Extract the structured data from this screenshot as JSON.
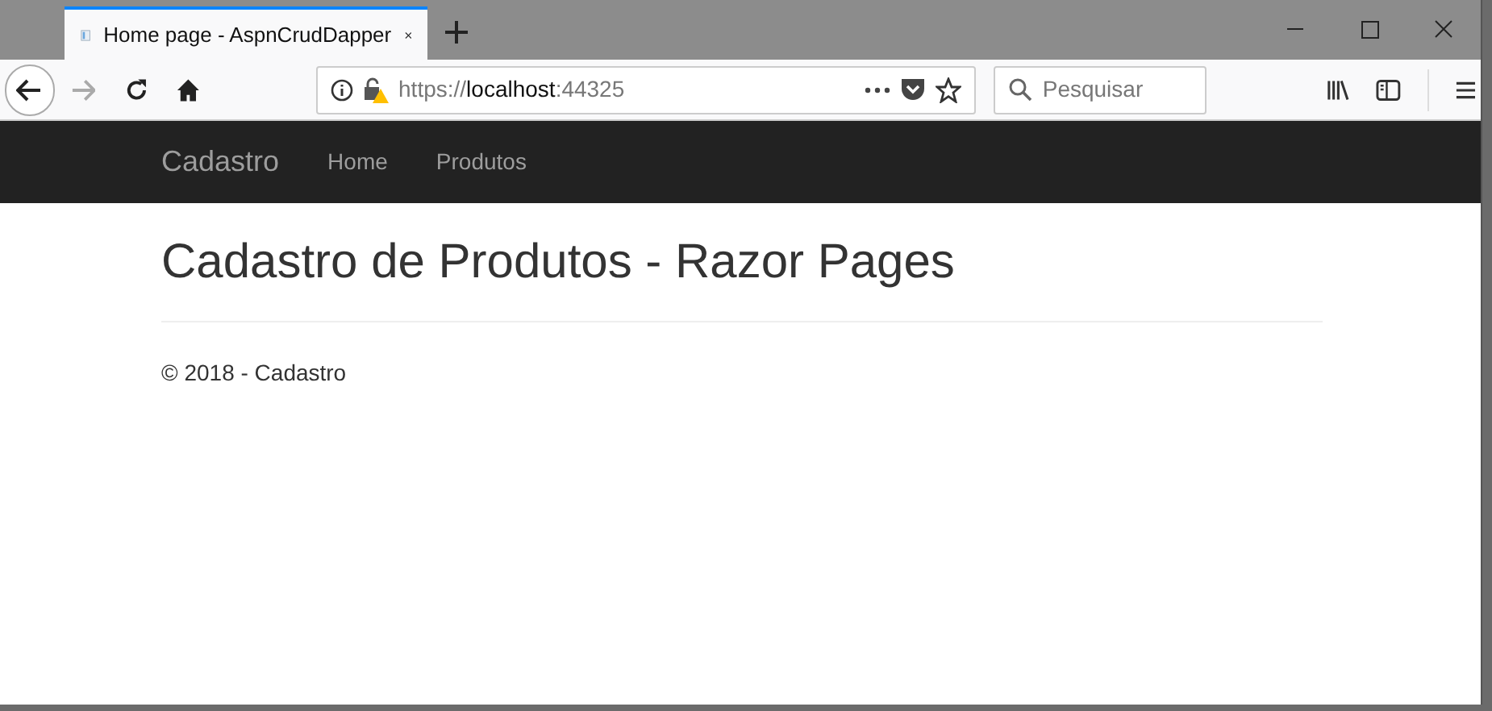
{
  "tab": {
    "title": "Home page - AspnCrudDapper"
  },
  "address_bar": {
    "scheme": "https://",
    "host": "localhost",
    "port": ":44325"
  },
  "search": {
    "placeholder": "Pesquisar"
  },
  "navbar": {
    "brand": "Cadastro",
    "links": [
      "Home",
      "Produtos"
    ]
  },
  "page": {
    "heading": "Cadastro de Produtos - Razor Pages",
    "footer": "© 2018 - Cadastro"
  }
}
